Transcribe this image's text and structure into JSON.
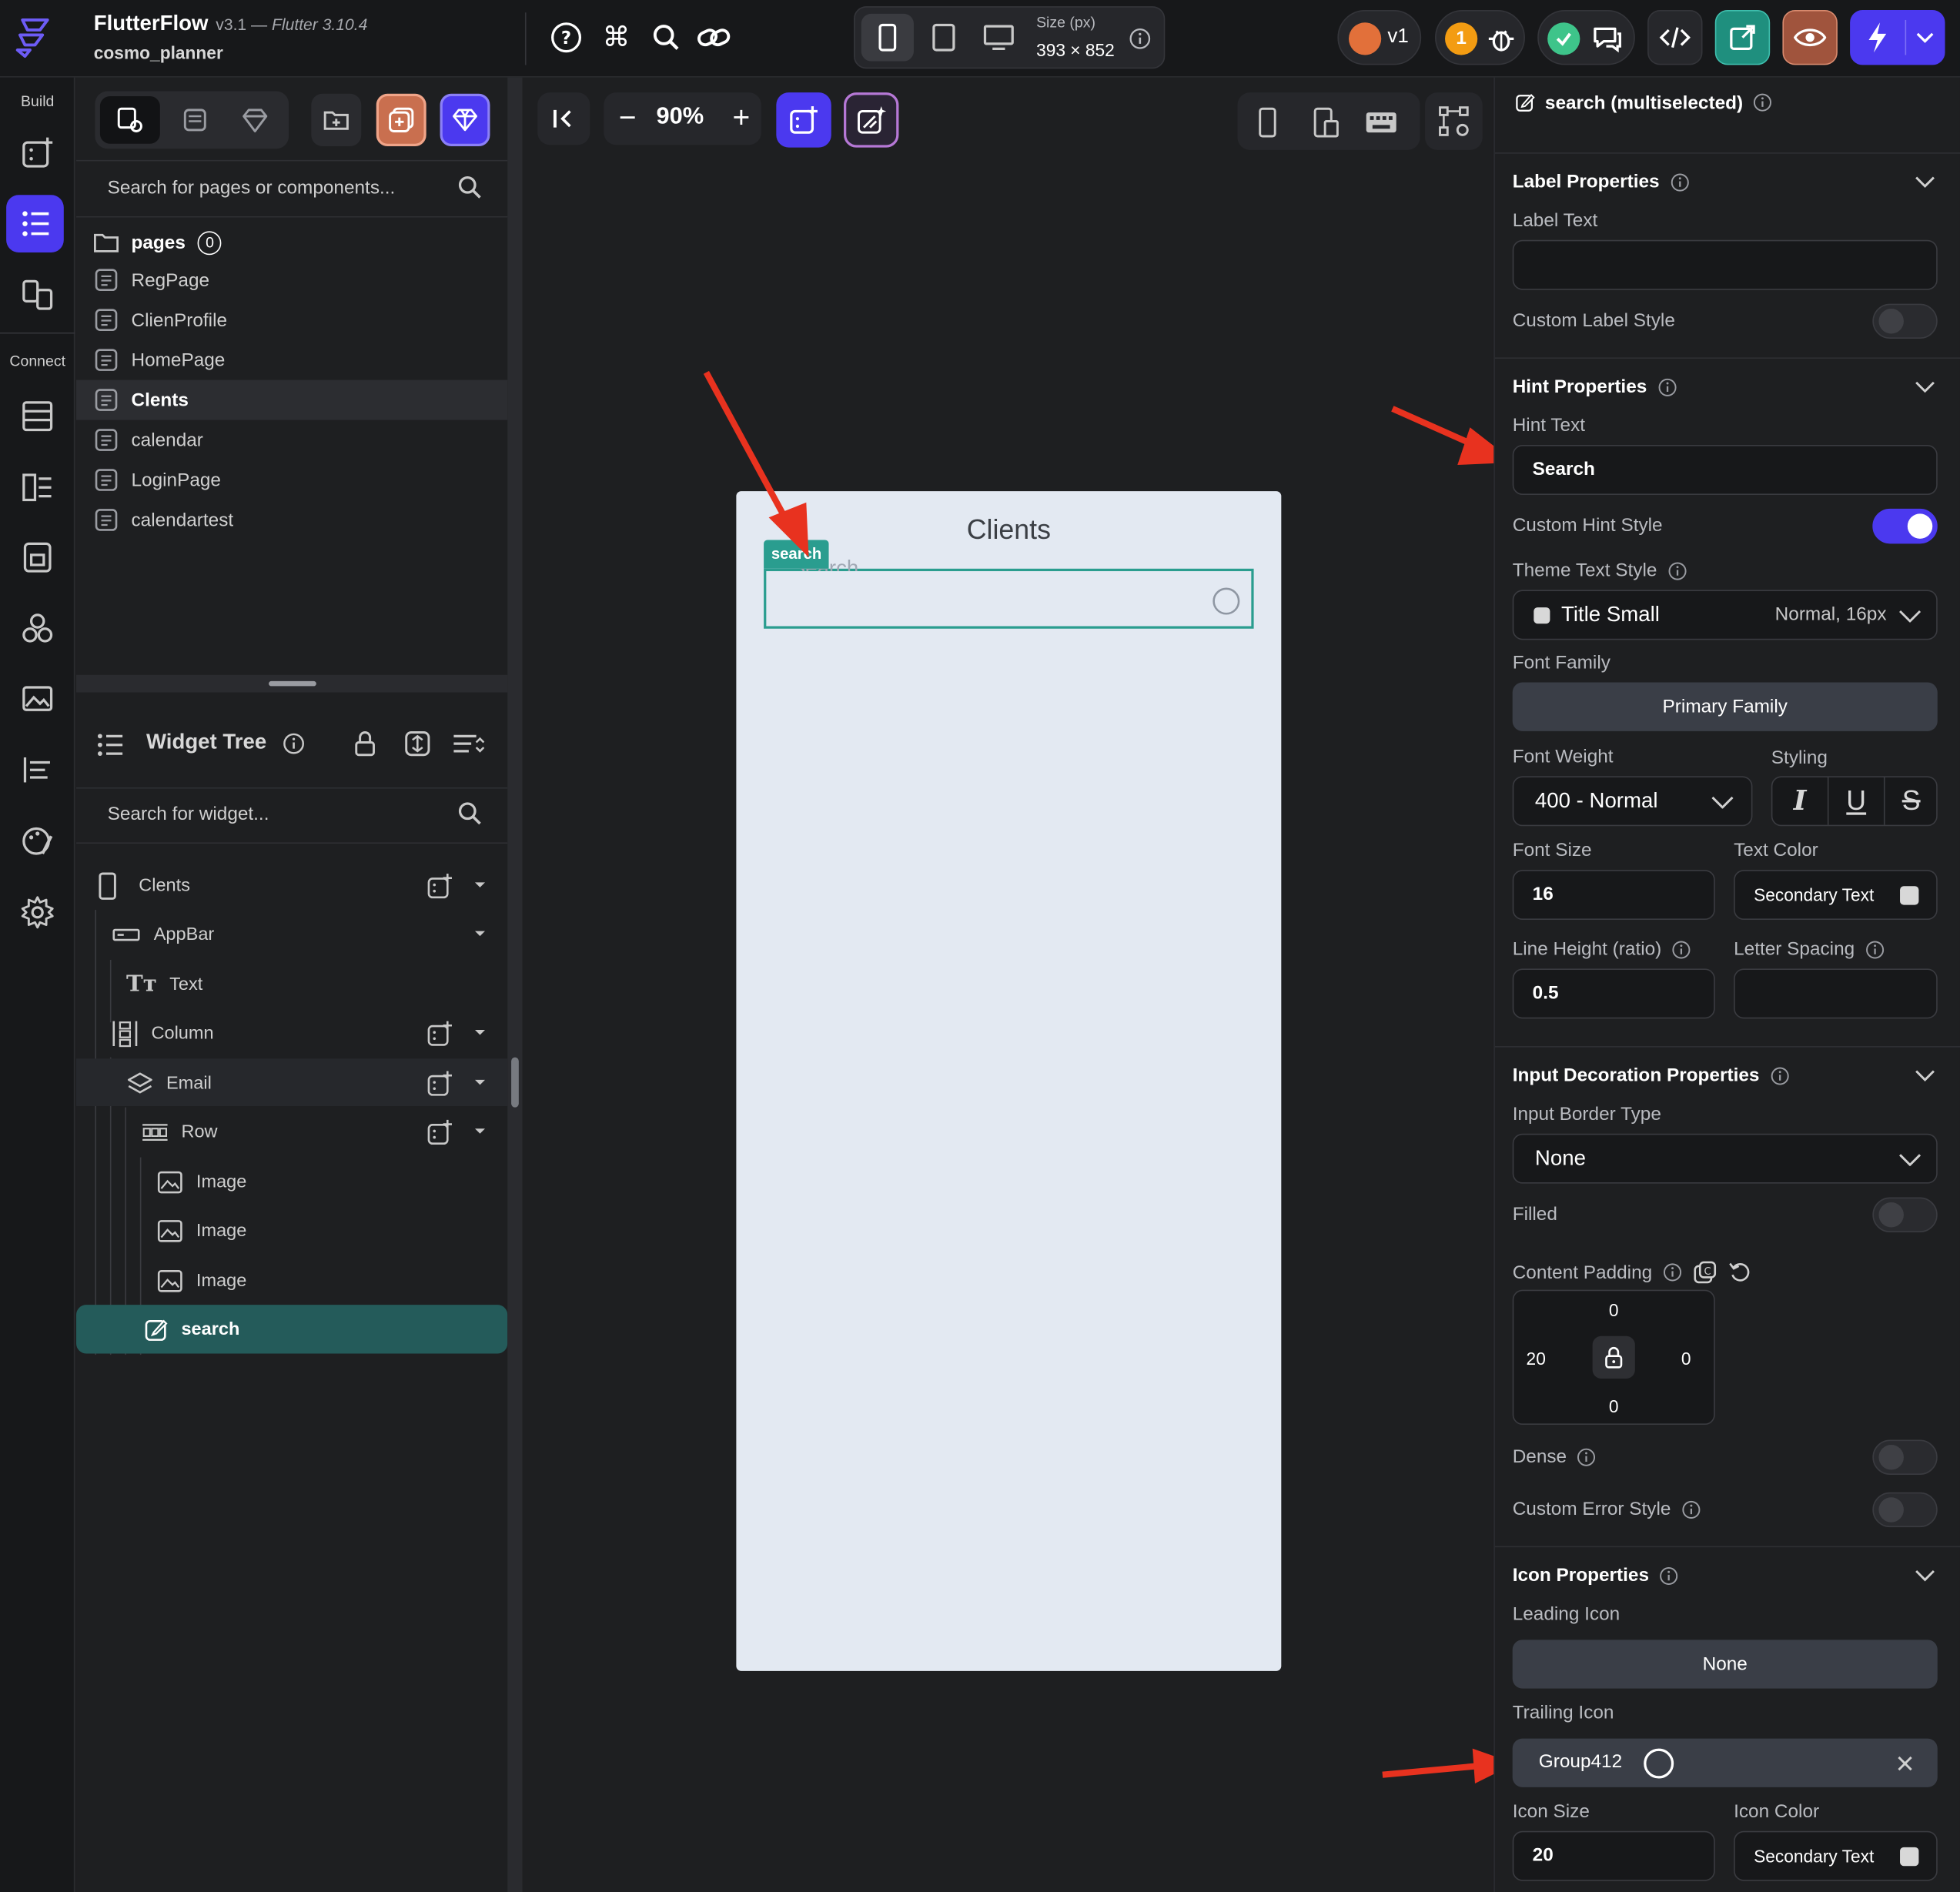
{
  "app": {
    "name": "FlutterFlow",
    "version": "v3.1 — ",
    "flutter": "Flutter 3.10.4",
    "project": "cosmo_planner"
  },
  "topbar": {
    "size_label": "Size (px)",
    "size_value": "393 × 852",
    "version_badge": "v1",
    "notif_count": "1"
  },
  "rail": {
    "build_label": "Build",
    "connect_label": "Connect"
  },
  "pages_panel": {
    "search_placeholder": "Search for pages or components...",
    "folder_label": "pages",
    "folder_count": "0",
    "pages": [
      "RegPage",
      "ClienProfile",
      "HomePage",
      "Clents",
      "calendar",
      "LoginPage",
      "calendartest"
    ],
    "selected_page": "Clents"
  },
  "widget_tree": {
    "title": "Widget Tree",
    "search_placeholder": "Search for widget...",
    "nodes": [
      "Clents",
      "AppBar",
      "Text",
      "Column",
      "Email",
      "Row",
      "Image",
      "Image",
      "Image",
      "search"
    ]
  },
  "canvas": {
    "zoom": "90%",
    "phone_title": "Clients",
    "selected_tag": "search",
    "hint_text": "Search"
  },
  "props": {
    "header": "search (multiselected)",
    "label_section": "Label Properties",
    "label_text": "Label Text",
    "custom_label_style": "Custom Label Style",
    "hint_section": "Hint Properties",
    "hint_text_label": "Hint Text",
    "hint_text_value": "Search",
    "custom_hint_style": "Custom Hint Style",
    "theme_text_style": "Theme Text Style",
    "theme_style_value": "Title Small",
    "theme_style_meta": "Normal, 16px",
    "font_family_label": "Font Family",
    "font_family_value": "Primary Family",
    "font_weight_label": "Font Weight",
    "font_weight_value": "400 - Normal",
    "styling_label": "Styling",
    "font_size_label": "Font Size",
    "font_size_value": "16",
    "text_color_label": "Text Color",
    "text_color_value": "Secondary Text",
    "line_height_label": "Line Height (ratio)",
    "line_height_value": "0.5",
    "letter_spacing_label": "Letter Spacing",
    "input_deco_section": "Input Decoration Properties",
    "border_type_label": "Input Border Type",
    "border_type_value": "None",
    "filled_label": "Filled",
    "content_padding_label": "Content Padding",
    "padding_top": "0",
    "padding_left": "20",
    "padding_right": "0",
    "padding_bottom": "0",
    "dense_label": "Dense",
    "custom_error_label": "Custom Error Style",
    "icon_section": "Icon Properties",
    "leading_icon_label": "Leading Icon",
    "leading_icon_value": "None",
    "trailing_icon_label": "Trailing Icon",
    "trailing_icon_value": "Group412",
    "icon_size_label": "Icon Size",
    "icon_size_value": "20",
    "icon_color_label": "Icon Color",
    "icon_color_value": "Secondary Text"
  },
  "colors": {
    "accent": "#4b39ef",
    "teal": "#2a9d8f",
    "annotation": "#e8321f"
  }
}
